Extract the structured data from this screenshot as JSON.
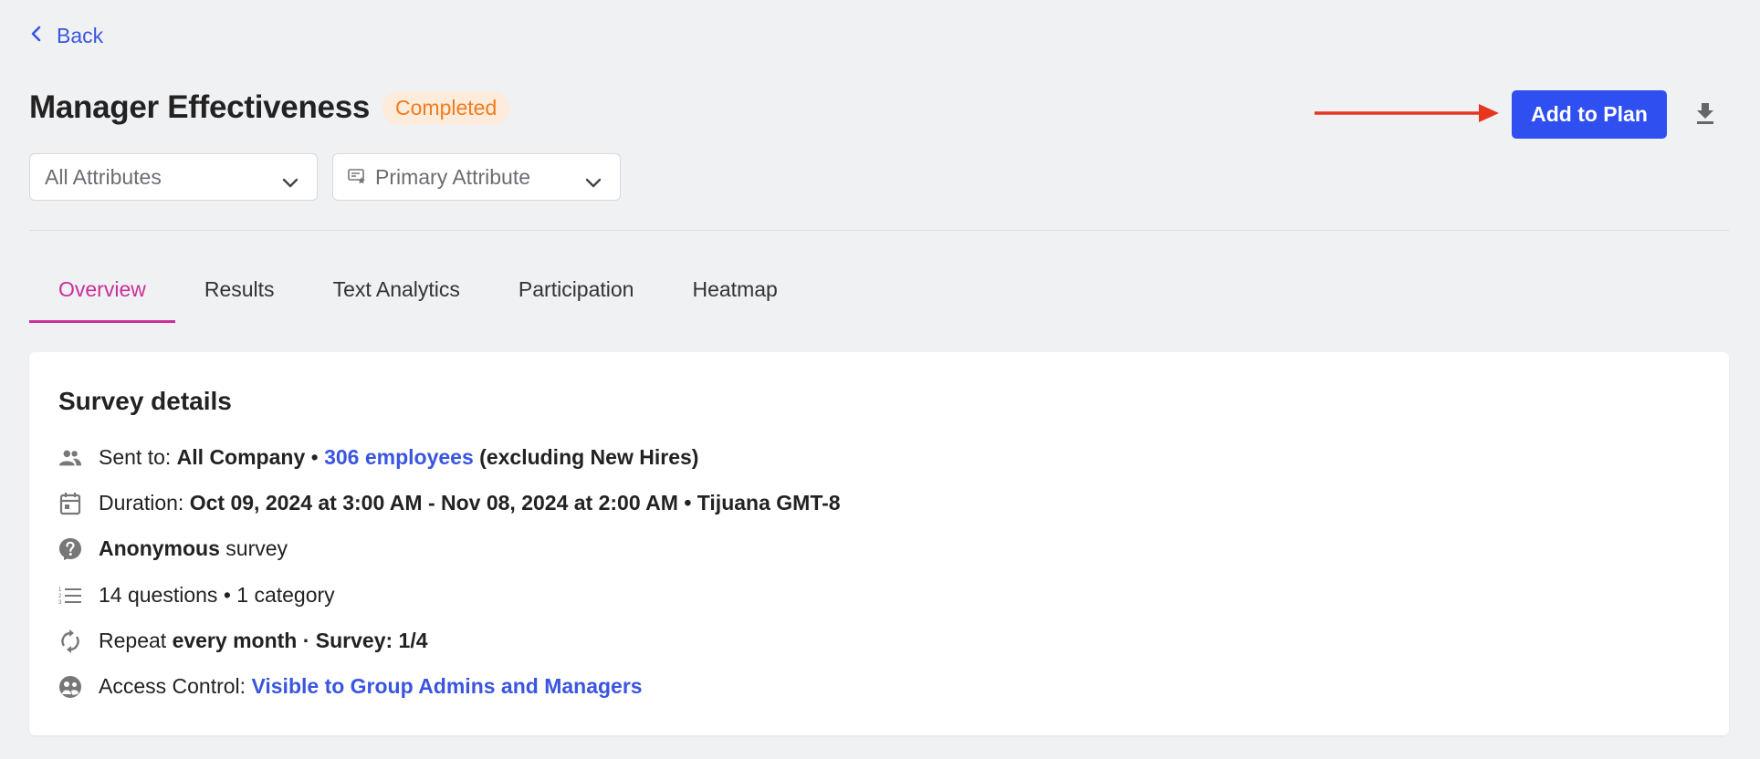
{
  "nav": {
    "back_label": "Back"
  },
  "header": {
    "title": "Manager Effectiveness",
    "status": "Completed",
    "add_button": "Add to Plan"
  },
  "filters": {
    "attributes": "All Attributes",
    "primary_attribute": "Primary Attribute"
  },
  "tabs": [
    {
      "label": "Overview",
      "active": true
    },
    {
      "label": "Results"
    },
    {
      "label": "Text Analytics"
    },
    {
      "label": "Participation"
    },
    {
      "label": "Heatmap"
    }
  ],
  "details": {
    "title": "Survey details",
    "sent_to": {
      "prefix": "Sent to:",
      "group": "All Company",
      "sep": "•",
      "employees_link": "306 employees",
      "suffix": "(excluding New Hires)"
    },
    "duration": {
      "prefix": "Duration:",
      "value": "Oct 09, 2024 at 3:00 AM - Nov 08, 2024 at 2:00 AM",
      "sep": "•",
      "timezone": "Tijuana GMT-8"
    },
    "anonymous": {
      "bold": "Anonymous",
      "rest": "survey"
    },
    "questions": {
      "text": "14 questions • 1 category"
    },
    "repeat": {
      "prefix": "Repeat",
      "value": "every month · Survey: 1/4"
    },
    "access": {
      "prefix": "Access Control:",
      "link": "Visible to Group Admins and Managers"
    }
  },
  "colors": {
    "accent_blue": "#2f4ff0",
    "link_blue": "#3a55e0",
    "tab_active": "#c9309a",
    "badge_text": "#f27c1c",
    "badge_bg": "#fdebdc",
    "annotation_arrow": "#e8351f"
  },
  "icons": [
    "chevron-left-icon",
    "chevron-down-icon",
    "primary-attribute-icon",
    "download-icon",
    "people-icon",
    "calendar-icon",
    "anonymous-icon",
    "list-icon",
    "repeat-icon",
    "access-control-icon",
    "annotation-arrow"
  ]
}
